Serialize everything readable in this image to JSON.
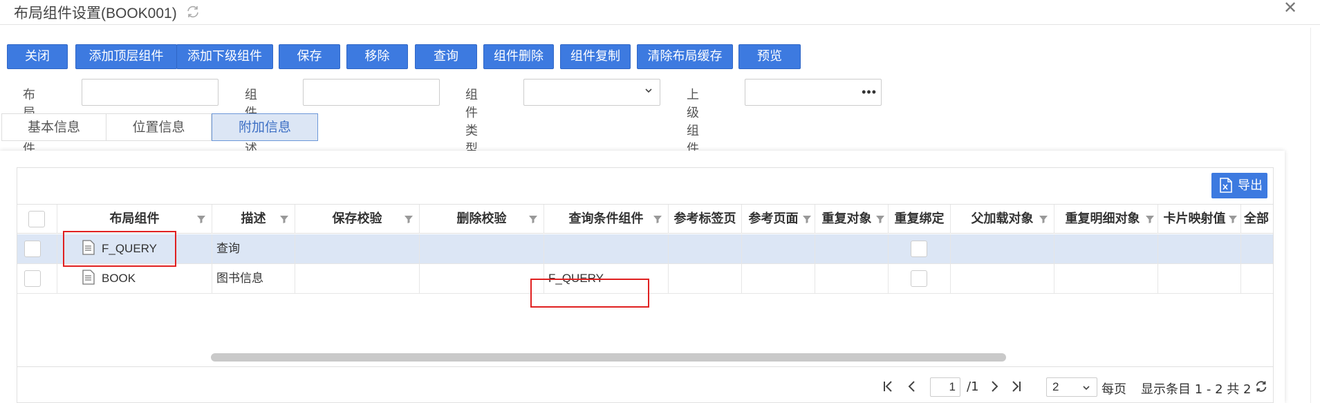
{
  "window": {
    "title": "布局组件设置(BOOK001)",
    "close_glyph": "✕"
  },
  "toolbar": {
    "buttons": [
      "关闭",
      "添加顶层组件",
      "添加下级组件",
      "保存",
      "移除",
      "查询",
      "组件删除",
      "组件复制",
      "清除布局缓存",
      "预览"
    ]
  },
  "form": {
    "layout_component_label": "布局组件",
    "layout_component_value": "",
    "component_desc_label": "组件描述",
    "component_desc_value": "",
    "component_type_label": "组件类型",
    "component_type_value": "",
    "parent_component_label": "上级组件",
    "parent_component_value": "",
    "more_glyph": "•••"
  },
  "tabs": [
    {
      "label": "基本信息",
      "active": false
    },
    {
      "label": "位置信息",
      "active": false
    },
    {
      "label": "附加信息",
      "active": true
    }
  ],
  "grid": {
    "export_label": "导出",
    "columns": [
      "布局组件",
      "描述",
      "保存校验",
      "删除校验",
      "查询条件组件",
      "参考标签页",
      "参考页面",
      "重复对象",
      "重复绑定",
      "父加载对象",
      "重复明细对象",
      "卡片映射值",
      "全部"
    ],
    "rows": [
      {
        "component": "F_QUERY",
        "desc": "查询",
        "query_component": "",
        "selected": true
      },
      {
        "component": "BOOK",
        "desc": "图书信息",
        "query_component": "F_QUERY",
        "selected": false
      }
    ]
  },
  "pager": {
    "page": "1",
    "total_pages": "/1",
    "page_size": "2",
    "per_page_label": "每页",
    "summary": "显示条目 1 - 2 共 2"
  },
  "colors": {
    "primary": "#3d7ae0",
    "selected_row": "#dce6f5",
    "highlight": "#e02020"
  }
}
